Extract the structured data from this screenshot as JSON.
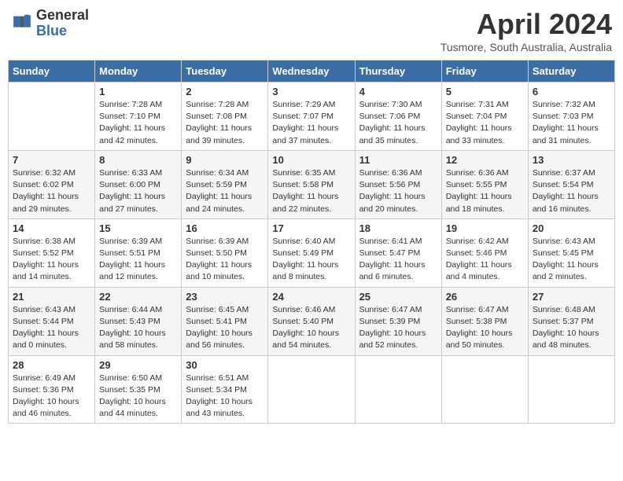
{
  "logo": {
    "general": "General",
    "blue": "Blue"
  },
  "title": "April 2024",
  "location": "Tusmore, South Australia, Australia",
  "days_header": [
    "Sunday",
    "Monday",
    "Tuesday",
    "Wednesday",
    "Thursday",
    "Friday",
    "Saturday"
  ],
  "weeks": [
    [
      {
        "day": "",
        "info": ""
      },
      {
        "day": "1",
        "info": "Sunrise: 7:28 AM\nSunset: 7:10 PM\nDaylight: 11 hours\nand 42 minutes."
      },
      {
        "day": "2",
        "info": "Sunrise: 7:28 AM\nSunset: 7:08 PM\nDaylight: 11 hours\nand 39 minutes."
      },
      {
        "day": "3",
        "info": "Sunrise: 7:29 AM\nSunset: 7:07 PM\nDaylight: 11 hours\nand 37 minutes."
      },
      {
        "day": "4",
        "info": "Sunrise: 7:30 AM\nSunset: 7:06 PM\nDaylight: 11 hours\nand 35 minutes."
      },
      {
        "day": "5",
        "info": "Sunrise: 7:31 AM\nSunset: 7:04 PM\nDaylight: 11 hours\nand 33 minutes."
      },
      {
        "day": "6",
        "info": "Sunrise: 7:32 AM\nSunset: 7:03 PM\nDaylight: 11 hours\nand 31 minutes."
      }
    ],
    [
      {
        "day": "7",
        "info": "Sunrise: 6:32 AM\nSunset: 6:02 PM\nDaylight: 11 hours\nand 29 minutes."
      },
      {
        "day": "8",
        "info": "Sunrise: 6:33 AM\nSunset: 6:00 PM\nDaylight: 11 hours\nand 27 minutes."
      },
      {
        "day": "9",
        "info": "Sunrise: 6:34 AM\nSunset: 5:59 PM\nDaylight: 11 hours\nand 24 minutes."
      },
      {
        "day": "10",
        "info": "Sunrise: 6:35 AM\nSunset: 5:58 PM\nDaylight: 11 hours\nand 22 minutes."
      },
      {
        "day": "11",
        "info": "Sunrise: 6:36 AM\nSunset: 5:56 PM\nDaylight: 11 hours\nand 20 minutes."
      },
      {
        "day": "12",
        "info": "Sunrise: 6:36 AM\nSunset: 5:55 PM\nDaylight: 11 hours\nand 18 minutes."
      },
      {
        "day": "13",
        "info": "Sunrise: 6:37 AM\nSunset: 5:54 PM\nDaylight: 11 hours\nand 16 minutes."
      }
    ],
    [
      {
        "day": "14",
        "info": "Sunrise: 6:38 AM\nSunset: 5:52 PM\nDaylight: 11 hours\nand 14 minutes."
      },
      {
        "day": "15",
        "info": "Sunrise: 6:39 AM\nSunset: 5:51 PM\nDaylight: 11 hours\nand 12 minutes."
      },
      {
        "day": "16",
        "info": "Sunrise: 6:39 AM\nSunset: 5:50 PM\nDaylight: 11 hours\nand 10 minutes."
      },
      {
        "day": "17",
        "info": "Sunrise: 6:40 AM\nSunset: 5:49 PM\nDaylight: 11 hours\nand 8 minutes."
      },
      {
        "day": "18",
        "info": "Sunrise: 6:41 AM\nSunset: 5:47 PM\nDaylight: 11 hours\nand 6 minutes."
      },
      {
        "day": "19",
        "info": "Sunrise: 6:42 AM\nSunset: 5:46 PM\nDaylight: 11 hours\nand 4 minutes."
      },
      {
        "day": "20",
        "info": "Sunrise: 6:43 AM\nSunset: 5:45 PM\nDaylight: 11 hours\nand 2 minutes."
      }
    ],
    [
      {
        "day": "21",
        "info": "Sunrise: 6:43 AM\nSunset: 5:44 PM\nDaylight: 11 hours\nand 0 minutes."
      },
      {
        "day": "22",
        "info": "Sunrise: 6:44 AM\nSunset: 5:43 PM\nDaylight: 10 hours\nand 58 minutes."
      },
      {
        "day": "23",
        "info": "Sunrise: 6:45 AM\nSunset: 5:41 PM\nDaylight: 10 hours\nand 56 minutes."
      },
      {
        "day": "24",
        "info": "Sunrise: 6:46 AM\nSunset: 5:40 PM\nDaylight: 10 hours\nand 54 minutes."
      },
      {
        "day": "25",
        "info": "Sunrise: 6:47 AM\nSunset: 5:39 PM\nDaylight: 10 hours\nand 52 minutes."
      },
      {
        "day": "26",
        "info": "Sunrise: 6:47 AM\nSunset: 5:38 PM\nDaylight: 10 hours\nand 50 minutes."
      },
      {
        "day": "27",
        "info": "Sunrise: 6:48 AM\nSunset: 5:37 PM\nDaylight: 10 hours\nand 48 minutes."
      }
    ],
    [
      {
        "day": "28",
        "info": "Sunrise: 6:49 AM\nSunset: 5:36 PM\nDaylight: 10 hours\nand 46 minutes."
      },
      {
        "day": "29",
        "info": "Sunrise: 6:50 AM\nSunset: 5:35 PM\nDaylight: 10 hours\nand 44 minutes."
      },
      {
        "day": "30",
        "info": "Sunrise: 6:51 AM\nSunset: 5:34 PM\nDaylight: 10 hours\nand 43 minutes."
      },
      {
        "day": "",
        "info": ""
      },
      {
        "day": "",
        "info": ""
      },
      {
        "day": "",
        "info": ""
      },
      {
        "day": "",
        "info": ""
      }
    ]
  ]
}
